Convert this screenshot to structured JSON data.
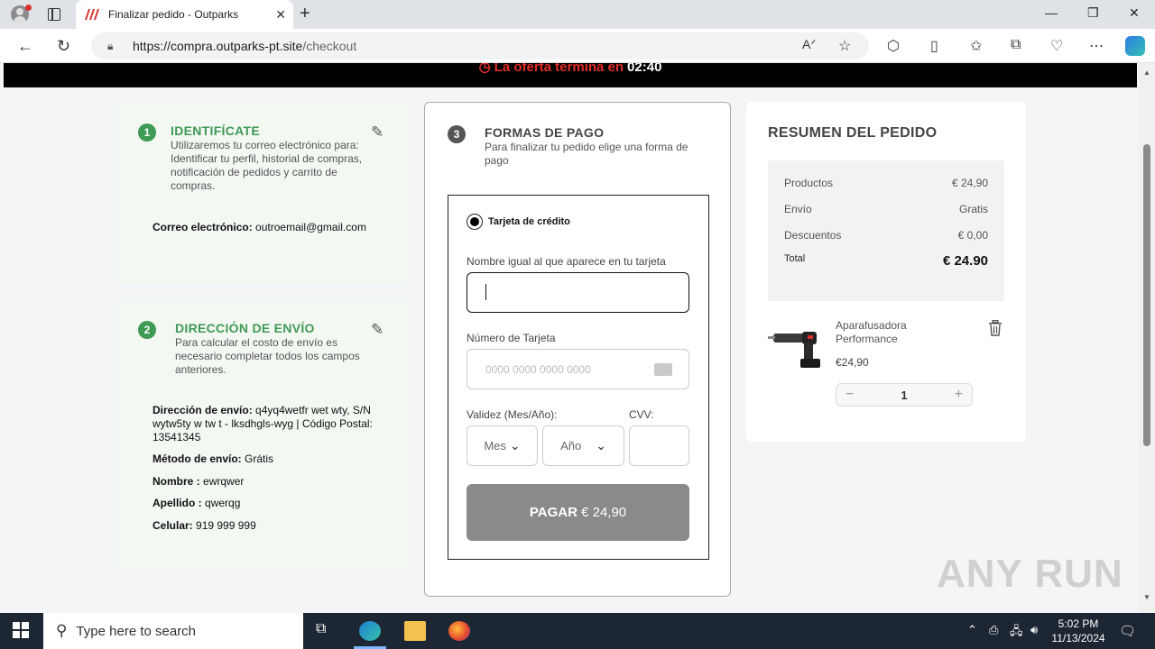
{
  "browser": {
    "tab_title": "Finalizar pedido - Outparks",
    "url_host": "https://compra.outparks-pt.site",
    "url_path": "/checkout"
  },
  "banner": {
    "text": "La oferta termina en",
    "time": "02:40"
  },
  "step1": {
    "num": "1",
    "title": "IDENTIFÍCATE",
    "desc": "Utilizaremos tu correo electrónico para: Identificar tu perfil, historial de compras, notificación de pedidos y carrito de compras.",
    "email_label": "Correo electrónico:",
    "email_value": "outroemail@gmail.com"
  },
  "step2": {
    "num": "2",
    "title": "DIRECCIÓN DE ENVÍO",
    "desc": "Para calcular el costo de envío es necesario completar todos los campos anteriores.",
    "address_label": "Dirección de envío:",
    "address_value": "q4yq4wetfr wet wty, S/N wytw5ty w tw t - lksdhgls-wyg | Código Postal: 13541345",
    "method_label": "Método de envío:",
    "method_value": "Grátis",
    "name_label": "Nombre :",
    "name_value": "ewrqwer",
    "lastname_label": "Apellido :",
    "lastname_value": "qwerqg",
    "phone_label": "Celular:",
    "phone_value": "919 999 999"
  },
  "step3": {
    "num": "3",
    "title": "FORMAS DE PAGO",
    "desc": "Para finalizar tu pedido elige una forma de pago",
    "option_label": "Tarjeta de crédito",
    "name_label": "Nombre igual al que aparece en tu tarjeta",
    "name_value": "",
    "card_label": "Número de Tarjeta",
    "card_placeholder": "0000 0000 0000 0000",
    "validity_label": "Validez (Mes/Año):",
    "cvv_label": "CVV:",
    "month_select": "Mes",
    "year_select": "Año",
    "pay_button_prefix": "PAGAR",
    "pay_button_amount": "€ 24,90"
  },
  "summary": {
    "title": "RESUMEN DEL PEDIDO",
    "rows": [
      {
        "label": "Productos",
        "value": "€ 24,90"
      },
      {
        "label": "Envío",
        "value": "Gratis"
      },
      {
        "label": "Descuentos",
        "value": "€ 0,00"
      }
    ],
    "total_label": "Total",
    "total_value": "€ 24.90",
    "product_name": "Aparafusadora Performance",
    "product_price": "€24,90",
    "quantity": "1"
  },
  "taskbar": {
    "search_placeholder": "Type here to search",
    "time": "5:02 PM",
    "date": "11/13/2024"
  },
  "watermark": "ANY RUN",
  "colors": {
    "accent_green": "#3f9a55",
    "banner_red": "#e52d27",
    "pay_button": "#8a8a8a"
  }
}
